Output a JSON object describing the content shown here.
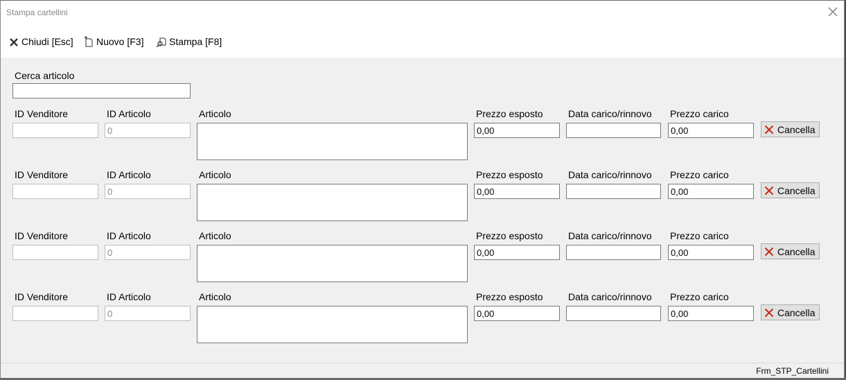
{
  "window": {
    "title": "Stampa cartellini",
    "status_form_name": "Frm_STP_Cartellini"
  },
  "toolbar": {
    "close_label": "Chiudi [Esc]",
    "new_label": "Nuovo [F3]",
    "print_label": "Stampa [F8]"
  },
  "search": {
    "label": "Cerca articolo",
    "value": ""
  },
  "labels": {
    "id_vendor": "ID Venditore",
    "id_article": "ID Articolo",
    "article": "Articolo",
    "exposed_price": "Prezzo esposto",
    "load_date": "Data carico/rinnovo",
    "load_price": "Prezzo carico",
    "cancel": "Cancella"
  },
  "rows": [
    {
      "id_vendor": "",
      "id_article": "0",
      "article": "",
      "exposed_price": "0,00",
      "load_date": "",
      "load_price": "0,00"
    },
    {
      "id_vendor": "",
      "id_article": "0",
      "article": "",
      "exposed_price": "0,00",
      "load_date": "",
      "load_price": "0,00"
    },
    {
      "id_vendor": "",
      "id_article": "0",
      "article": "",
      "exposed_price": "0,00",
      "load_date": "",
      "load_price": "0,00"
    },
    {
      "id_vendor": "",
      "id_article": "0",
      "article": "",
      "exposed_price": "0,00",
      "load_date": "",
      "load_price": "0,00"
    }
  ],
  "colors": {
    "cancel_icon": "#c42b1c",
    "window_bg": "#f0f0f0",
    "field_border": "#7a7a7a"
  }
}
